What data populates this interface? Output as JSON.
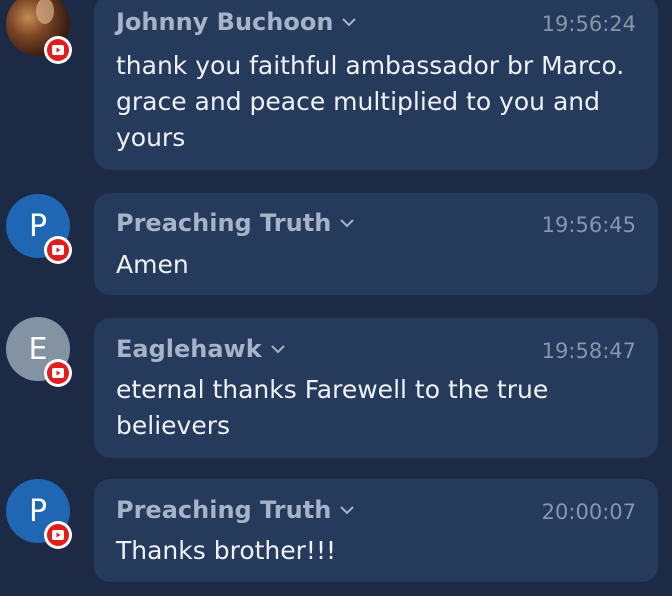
{
  "messages": [
    {
      "author": "Johnny Buchoon",
      "time": "19:56:24",
      "text": "thank you faithful ambassador br Marco. grace and peace multiplied to you and yours",
      "avatar_letter": "",
      "avatar_color": "#6b3a20"
    },
    {
      "author": "Preaching Truth",
      "time": "19:56:45",
      "text": "Amen",
      "avatar_letter": "P",
      "avatar_color": "#1f67b3"
    },
    {
      "author": "Eaglehawk",
      "time": "19:58:47",
      "text": "eternal thanks Farewell to the true believers",
      "avatar_letter": "E",
      "avatar_color": "#8493a3"
    },
    {
      "author": "Preaching Truth",
      "time": "20:00:07",
      "text": "Thanks brother!!!",
      "avatar_letter": "P",
      "avatar_color": "#1f67b3"
    }
  ],
  "icons": {
    "source_badge": "youtube-icon",
    "author_menu": "chevron-down-icon"
  },
  "colors": {
    "background": "#1c2a46",
    "bubble": "#263a5c",
    "youtube_red": "#e21d1d"
  }
}
